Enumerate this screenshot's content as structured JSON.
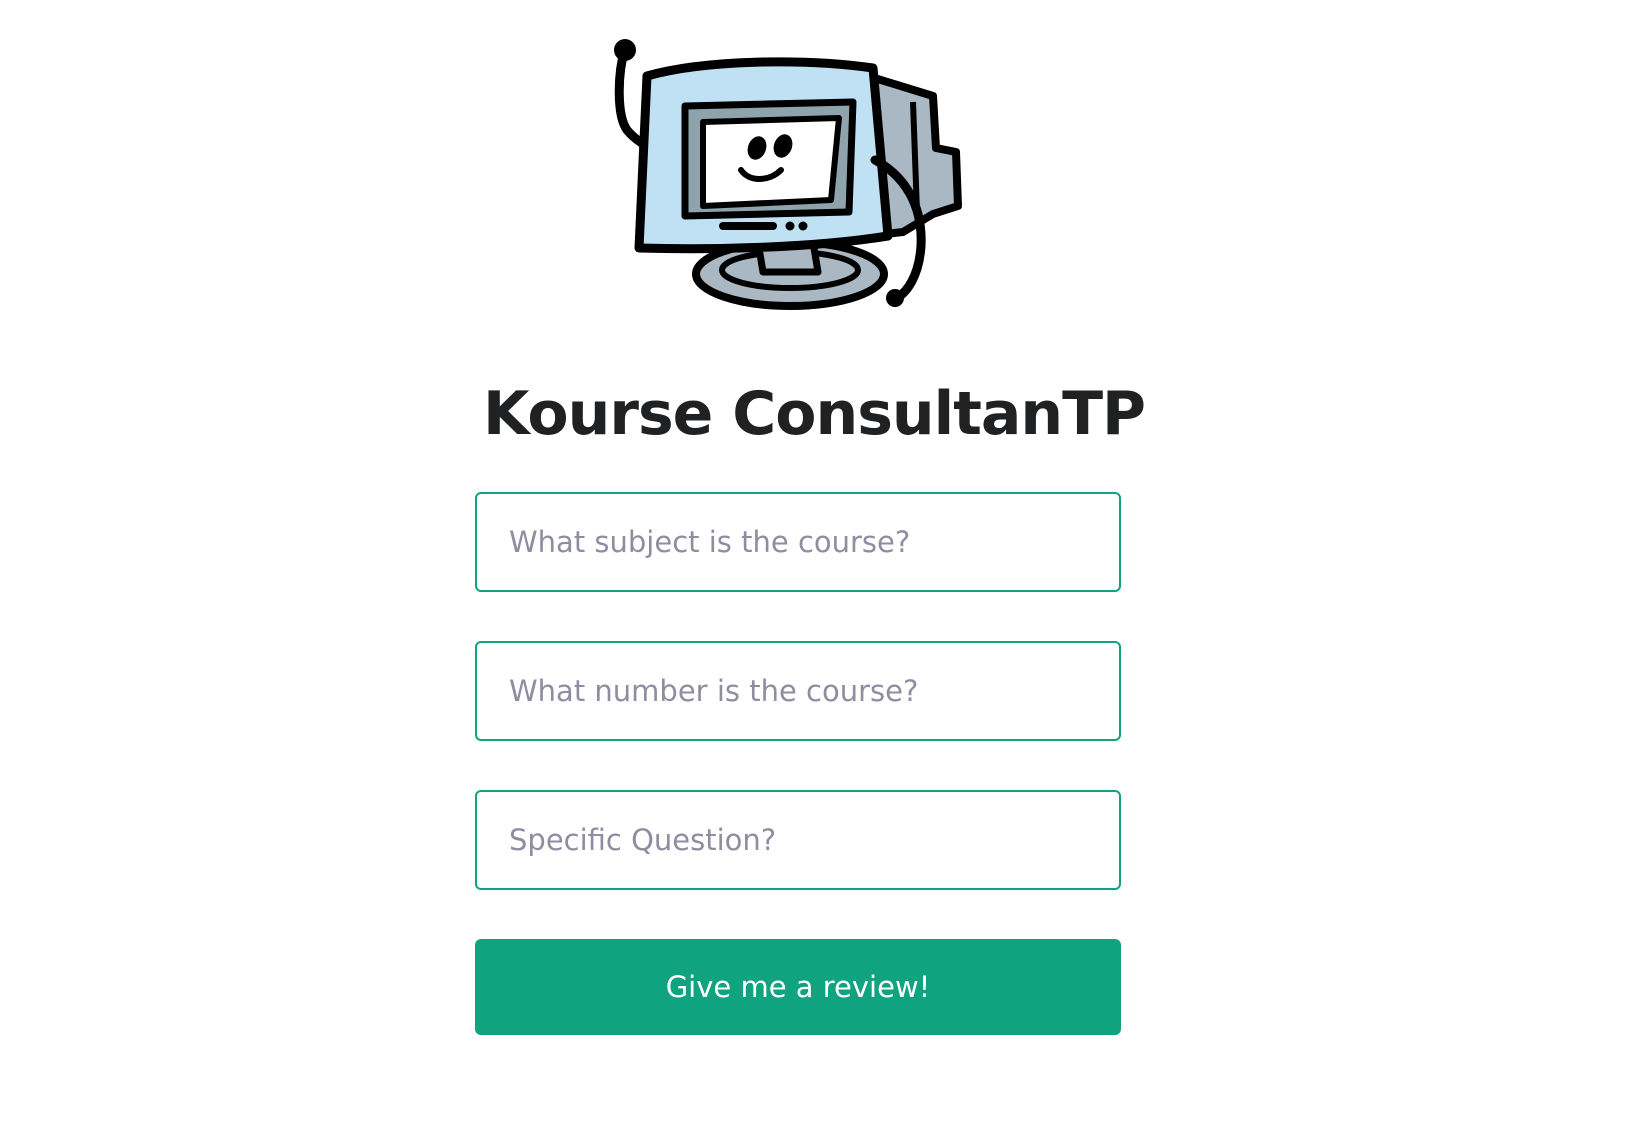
{
  "app": {
    "title": "Kourse ConsultanTP"
  },
  "form": {
    "subject_placeholder": "What subject is the course?",
    "number_placeholder": "What number is the course?",
    "question_placeholder": "Specific Question?",
    "subject_value": "",
    "number_value": "",
    "question_value": "",
    "submit_label": "Give me a review!"
  },
  "mascot": {
    "icon": "smiling-computer-mascot-icon"
  },
  "colors": {
    "accent": "#10a37f",
    "title": "#202123",
    "placeholder": "#8e8ea0",
    "screen_fill": "#bfe1f3",
    "stand_fill": "#a9b8c2"
  }
}
